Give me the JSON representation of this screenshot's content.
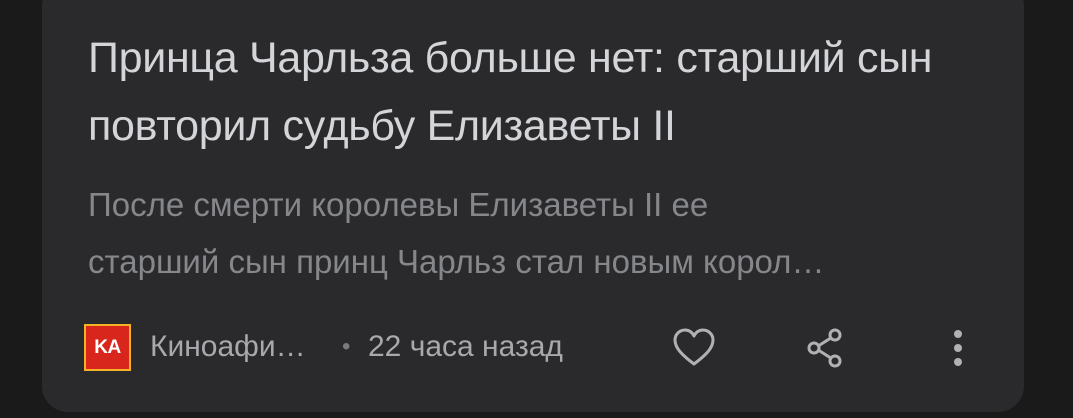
{
  "card": {
    "title": "Принца Чарльза больше нет: старший сын повторил судьбу Елизаветы II",
    "snippet": "После смерти королевы Елизаветы II ее\nстарший сын принц Чарльз стал новым корол…",
    "source": {
      "logo_text": "KA",
      "name": "Киноафи…"
    },
    "separator": "•",
    "time": "22 часа назад",
    "actions": {
      "like_icon": "heart-icon",
      "share_icon": "share-icon",
      "more_icon": "more-vertical-icon"
    }
  },
  "colors": {
    "background": "#1a1a1b",
    "card": "#2a2a2c",
    "title": "#d4d5d9",
    "snippet": "#86878b",
    "meta": "#a8a9ad",
    "icons": "#b0b1b5",
    "logo_red": "#d8261c",
    "logo_border": "#f3b327"
  }
}
